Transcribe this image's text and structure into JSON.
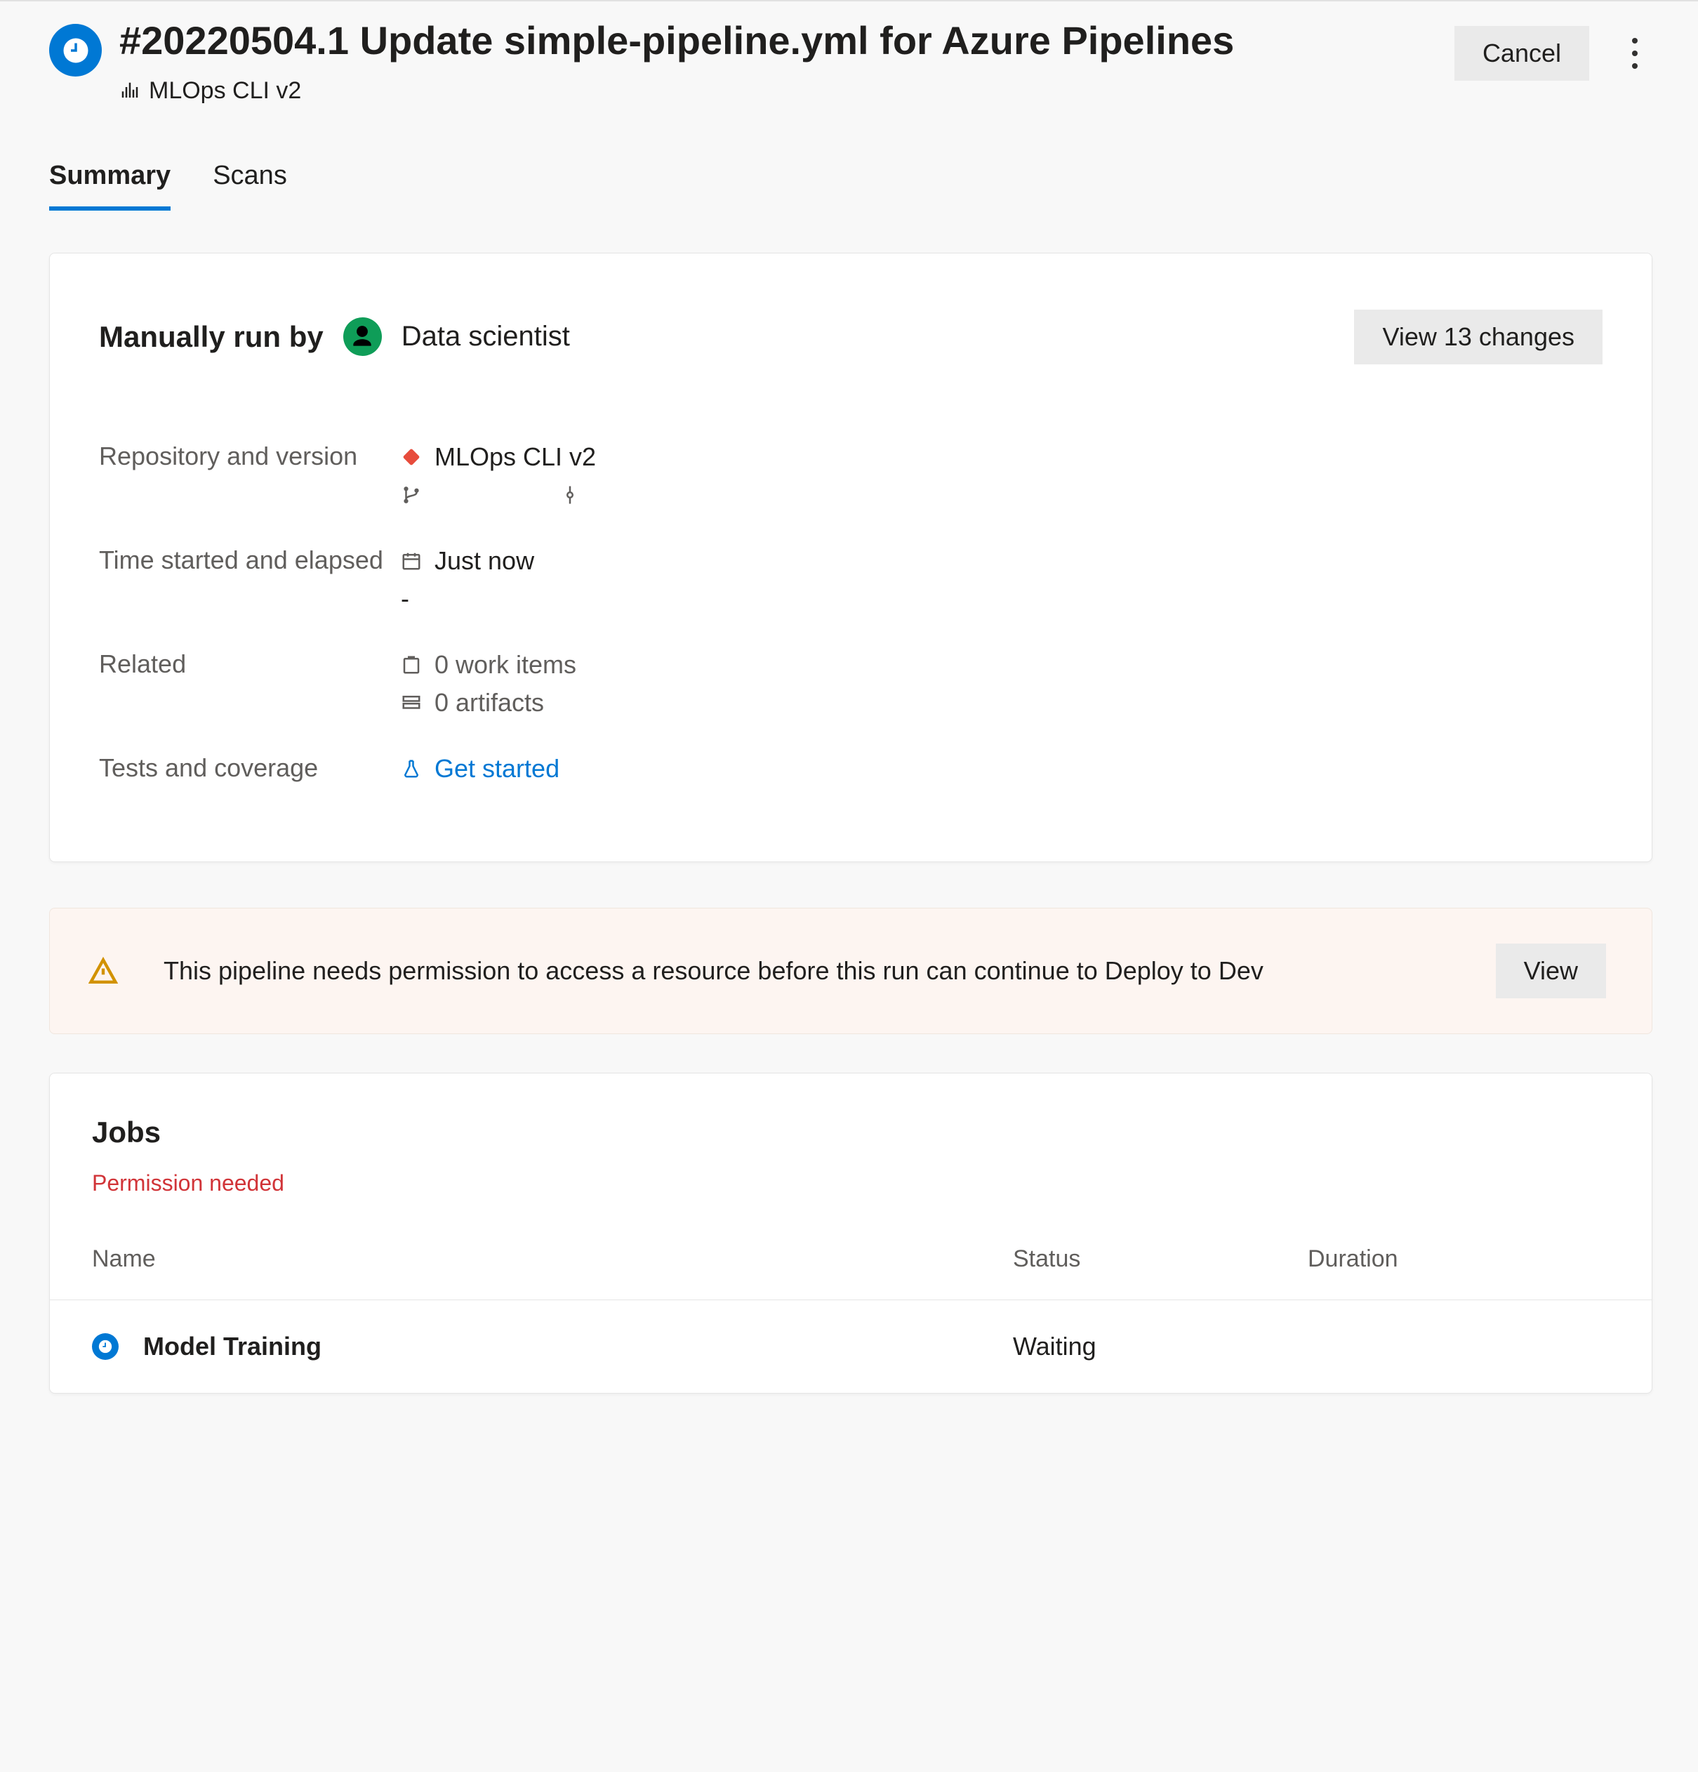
{
  "header": {
    "title": "#20220504.1 Update simple-pipeline.yml for Azure Pipelines",
    "pipeline_name": "MLOps CLI v2",
    "cancel_label": "Cancel"
  },
  "tabs": [
    {
      "label": "Summary",
      "active": true
    },
    {
      "label": "Scans",
      "active": false
    }
  ],
  "summary": {
    "run_by_label": "Manually run by",
    "run_by_name": "Data scientist",
    "view_changes_label": "View 13 changes",
    "rows": {
      "repo_label": "Repository and version",
      "repo_value": "MLOps CLI v2",
      "time_label": "Time started and elapsed",
      "time_started": "Just now",
      "time_elapsed": "-",
      "related_label": "Related",
      "work_items": "0 work items",
      "artifacts": "0 artifacts",
      "tests_label": "Tests and coverage",
      "tests_link": "Get started"
    }
  },
  "banner": {
    "message": "This pipeline needs permission to access a resource before this run can continue to Deploy to Dev",
    "action": "View"
  },
  "jobs": {
    "title": "Jobs",
    "permission_text": "Permission needed",
    "columns": {
      "name": "Name",
      "status": "Status",
      "duration": "Duration"
    },
    "rows": [
      {
        "name": "Model Training",
        "status": "Waiting",
        "duration": ""
      }
    ]
  }
}
